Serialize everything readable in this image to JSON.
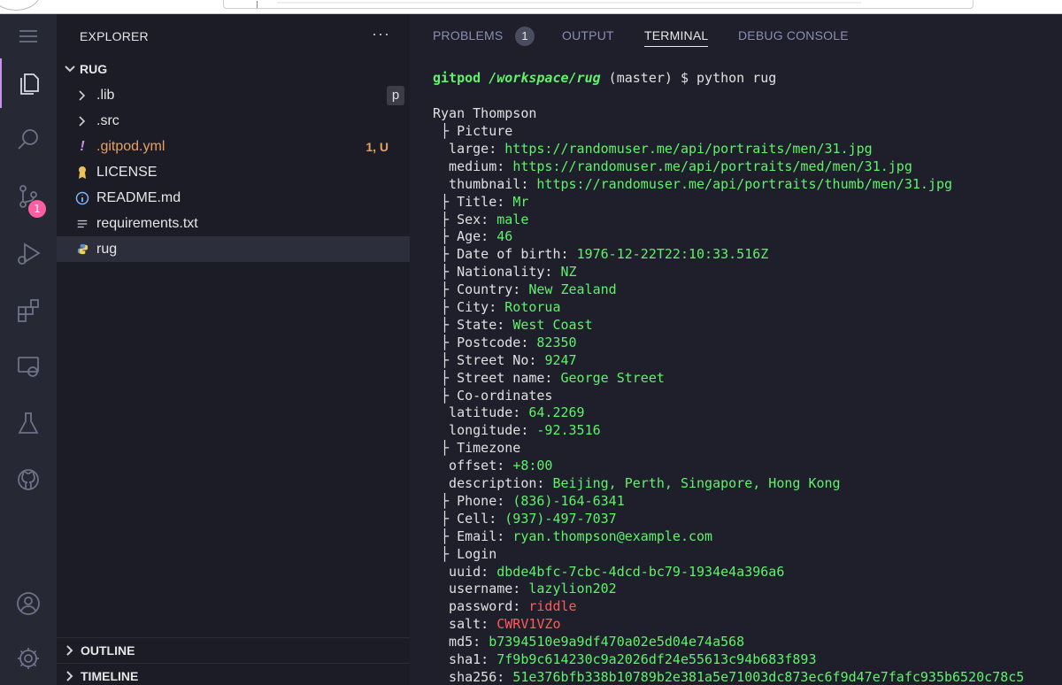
{
  "sidebar": {
    "title": "EXPLORER",
    "more": "···",
    "folder": "RUG",
    "files": [
      {
        "name": ".lib",
        "icon": "chevron-right-icon"
      },
      {
        "name": ".src",
        "icon": "chevron-right-icon"
      },
      {
        "name": ".gitpod.yml",
        "icon": "exclamation-icon",
        "status": "1, U"
      },
      {
        "name": "LICENSE",
        "icon": "license-icon"
      },
      {
        "name": "README.md",
        "icon": "info-icon"
      },
      {
        "name": "requirements.txt",
        "icon": "lines-icon"
      },
      {
        "name": "rug",
        "icon": "python-icon"
      }
    ],
    "lib_badge": "p",
    "outline": "OUTLINE",
    "timeline": "TIMELINE"
  },
  "activity_bar": {
    "scm_badge": "1",
    "icons": [
      "menu-icon",
      "files-icon",
      "search-icon",
      "source-control-icon",
      "run-debug-icon",
      "extensions-icon",
      "remote-explorer-icon",
      "testing-icon",
      "github-icon",
      "account-icon",
      "settings-gear-icon"
    ]
  },
  "panel": {
    "tabs": [
      "PROBLEMS",
      "OUTPUT",
      "TERMINAL",
      "DEBUG CONSOLE"
    ],
    "problems_count": "1",
    "active_tab": "TERMINAL"
  },
  "terminal": {
    "prompt_user": "gitpod",
    "prompt_path": "/workspace/rug",
    "prompt_rest": " (master) $ python rug",
    "name": "Ryan Thompson",
    "lines": [
      {
        "k": " ├ Picture",
        "v": ""
      },
      {
        "k": "  large: ",
        "v": "https://randomuser.me/api/portraits/men/31.jpg"
      },
      {
        "k": "  medium: ",
        "v": "https://randomuser.me/api/portraits/med/men/31.jpg"
      },
      {
        "k": "  thumbnail: ",
        "v": "https://randomuser.me/api/portraits/thumb/men/31.jpg"
      },
      {
        "k": " ├ Title: ",
        "v": "Mr"
      },
      {
        "k": " ├ Sex: ",
        "v": "male"
      },
      {
        "k": " ├ Age: ",
        "v": "46"
      },
      {
        "k": " ├ Date of birth: ",
        "v": "1976-12-22T22:10:33.516Z"
      },
      {
        "k": " ├ Nationality: ",
        "v": "NZ"
      },
      {
        "k": " ├ Country: ",
        "v": "New Zealand"
      },
      {
        "k": " ├ City: ",
        "v": "Rotorua"
      },
      {
        "k": " ├ State: ",
        "v": "West Coast"
      },
      {
        "k": " ├ Postcode: ",
        "v": "82350"
      },
      {
        "k": " ├ Street No: ",
        "v": "9247"
      },
      {
        "k": " ├ Street name: ",
        "v": "George Street"
      },
      {
        "k": " ├ Co-ordinates",
        "v": ""
      },
      {
        "k": "  latitude: ",
        "v": "64.2269"
      },
      {
        "k": "  longitude: ",
        "v": "-92.3516"
      },
      {
        "k": " ├ Timezone",
        "v": ""
      },
      {
        "k": "  offset: ",
        "v": "+8:00"
      },
      {
        "k": "  description: ",
        "v": "Beijing, Perth, Singapore, Hong Kong"
      },
      {
        "k": " ├ Phone: ",
        "v": "(836)-164-6341"
      },
      {
        "k": " ├ Cell: ",
        "v": "(937)-497-7037"
      },
      {
        "k": " ├ Email: ",
        "v": "ryan.thompson@example.com"
      },
      {
        "k": " ├ Login",
        "v": ""
      },
      {
        "k": "  uuid: ",
        "v": "dbde4bfc-7cbc-4dcd-bc79-1934e4a396a6"
      },
      {
        "k": "  username: ",
        "v": "lazylion202"
      },
      {
        "k": "  password: ",
        "v": "riddle",
        "red": true
      },
      {
        "k": "  salt: ",
        "v": "CWRV1VZo",
        "red": true
      },
      {
        "k": "  md5: ",
        "v": "b7394510e9a9df470a02e5d04e74a568"
      },
      {
        "k": "  sha1: ",
        "v": "7f9b9c614230c9a2026df24e55613c94b683f893"
      },
      {
        "k": "  sha256: ",
        "v": "51e376bfb338b10789b2e381a5e71003dc873ec6f9d47e7fafc935b6520c78c5"
      }
    ]
  },
  "colors": {
    "value_green": "#5ff26a",
    "value_red": "#ff5b5b",
    "accent": "#c792ea",
    "badge_pink": "#ff5fa2",
    "warning": "#e8a062"
  }
}
